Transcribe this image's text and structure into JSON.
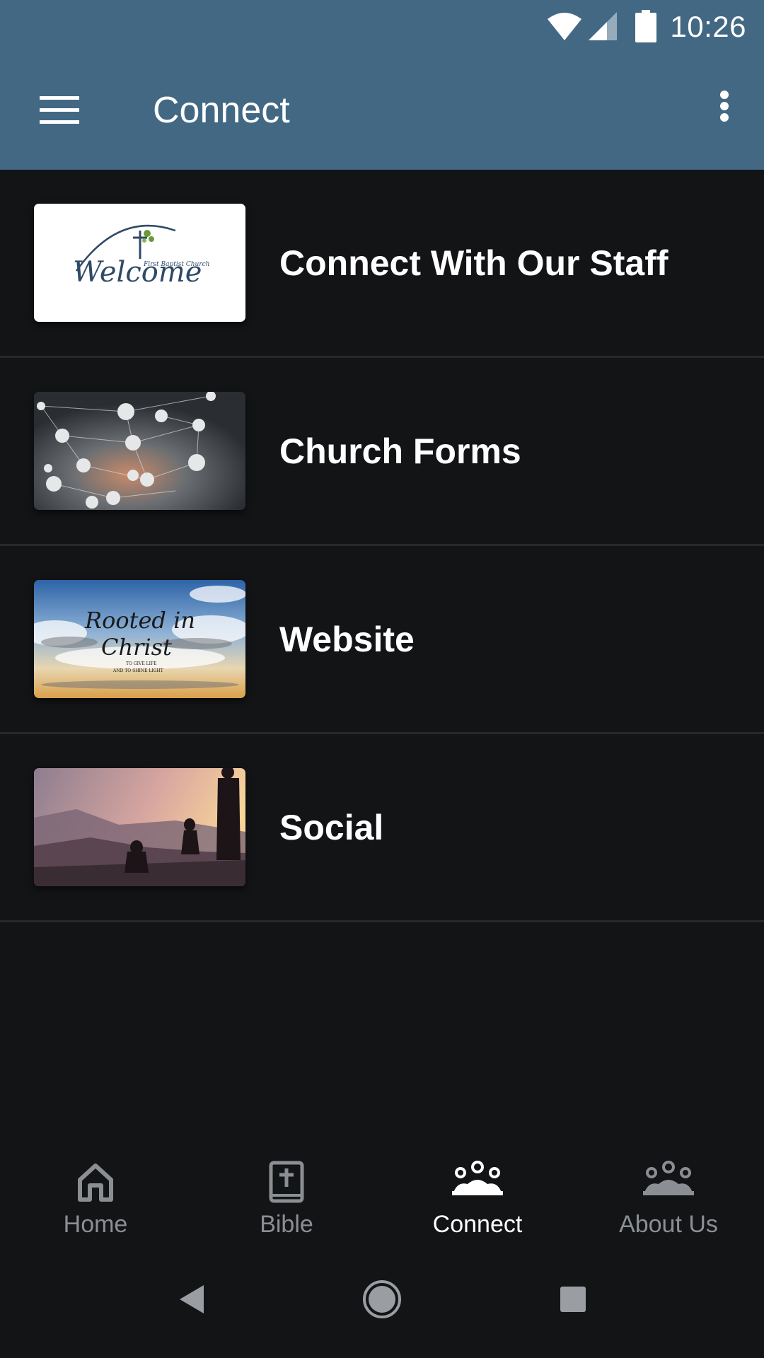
{
  "status_bar": {
    "time": "10:26",
    "icons": [
      "wifi-icon",
      "cell-signal-icon",
      "battery-icon"
    ]
  },
  "app_bar": {
    "title": "Connect",
    "menu_icon": "hamburger-menu-icon",
    "more_icon": "more-vertical-icon",
    "background_color": "#436884"
  },
  "list": {
    "items": [
      {
        "label": "Connect With Our Staff",
        "thumbnail": "welcome-logo-image",
        "thumbnail_text": {
          "small": "First Baptist Church",
          "big": "Welcome"
        }
      },
      {
        "label": "Church Forms",
        "thumbnail": "network-nodes-image"
      },
      {
        "label": "Website",
        "thumbnail": "rooted-in-christ-sky-image",
        "thumbnail_text": {
          "line1": "Rooted in",
          "line2": "Christ",
          "line3": "TO GIVE LIFE",
          "line4": "AND TO SHINE LIGHT"
        }
      },
      {
        "label": "Social",
        "thumbnail": "sunset-mountain-people-image"
      }
    ]
  },
  "bottom_nav": {
    "tabs": [
      {
        "label": "Home",
        "icon": "home-icon",
        "active": false
      },
      {
        "label": "Bible",
        "icon": "bible-icon",
        "active": false
      },
      {
        "label": "Connect",
        "icon": "group-icon",
        "active": true
      },
      {
        "label": "About Us",
        "icon": "group-icon",
        "active": false
      }
    ]
  },
  "system_nav": {
    "icons": [
      "back-icon",
      "home-circle-icon",
      "recents-icon"
    ]
  },
  "colors": {
    "background": "#131416",
    "divider": "#26292d",
    "inactive_tab": "#8b8e93",
    "active_tab": "#ffffff"
  }
}
